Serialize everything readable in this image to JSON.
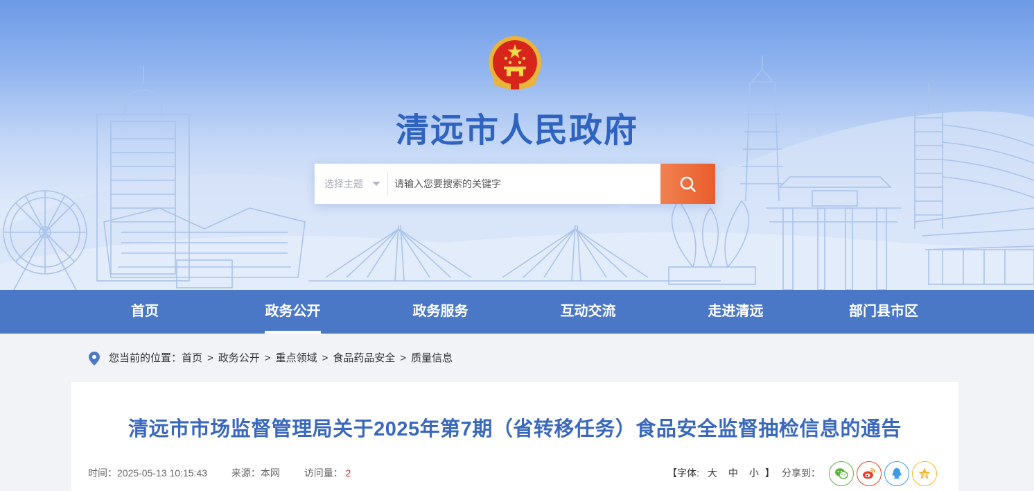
{
  "site": {
    "title": "清远市人民政府"
  },
  "search": {
    "topic_label": "选择主题",
    "placeholder": "请输入您要搜索的关键字"
  },
  "nav": {
    "items": [
      {
        "label": "首页"
      },
      {
        "label": "政务公开",
        "active": true
      },
      {
        "label": "政务服务"
      },
      {
        "label": "互动交流"
      },
      {
        "label": "走进清远"
      },
      {
        "label": "部门县市区"
      }
    ]
  },
  "breadcrumb": {
    "prefix": "您当前的位置：",
    "items": [
      "首页",
      "政务公开",
      "重点领域",
      "食品药品安全",
      "质量信息"
    ],
    "separator": ">"
  },
  "article": {
    "title": "清远市市场监督管理局关于2025年第7期（省转移任务）食品安全监督抽检信息的通告",
    "time_label": "时间：",
    "time": "2025-05-13 10:15:43",
    "source_label": "来源：",
    "source": "本网",
    "views_label": "访问量：",
    "views": "2"
  },
  "tools": {
    "font_open": "【字体:",
    "font_large": "大",
    "font_medium": "中",
    "font_small": "小",
    "font_close": "】",
    "share_label": "分享到："
  },
  "icons": {
    "share": [
      "wechat-icon",
      "weibo-icon",
      "qq-icon",
      "qzone-icon"
    ]
  },
  "colors": {
    "nav_bg": "#4a77c6",
    "title_blue": "#3a68bd",
    "search_orange": "#ea5c2d",
    "wechat": "#5ab63a",
    "weibo": "#e8412a",
    "qq": "#3a9be8",
    "qzone": "#f4b72a"
  }
}
